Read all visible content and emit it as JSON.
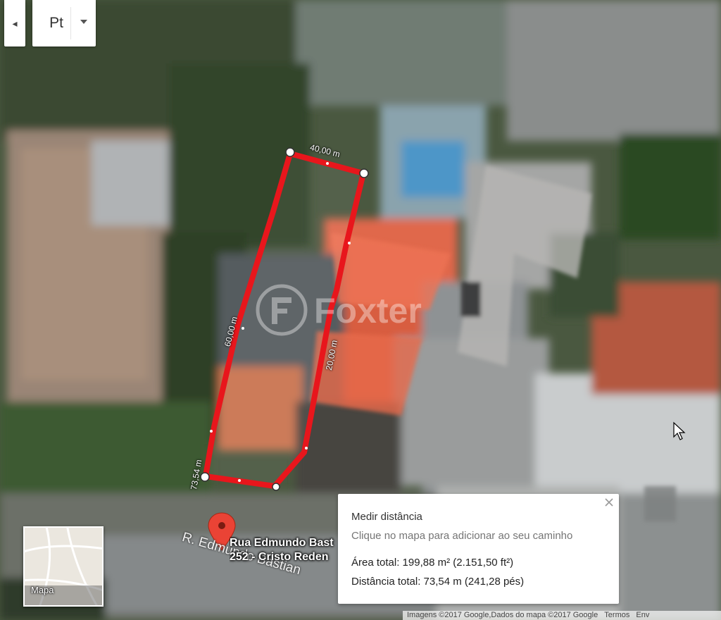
{
  "controls": {
    "back_label": "◂",
    "map_type_label": "Pt"
  },
  "measure": {
    "edge_labels": [
      "40,00 m",
      "60,00 m",
      "20,00 m",
      "73,54 m"
    ]
  },
  "pin": {
    "line1": "Rua Edmundo Bast",
    "line2": "252 - Cristo Reden"
  },
  "street_label": "R. Edmundo Bastian",
  "minimap": {
    "label": "Mapa"
  },
  "panel": {
    "title": "Medir distância",
    "hint": "Clique no mapa para adicionar ao seu caminho",
    "area": "Área total: 199,88 m² (2.151,50 ft²)",
    "distance": "Distância total: 73,54 m (241,28 pés)"
  },
  "footer": {
    "imagery": "Imagens ©2017 Google,Dados do mapa ©2017 Google",
    "terms": "Termos",
    "feedback": "Env"
  },
  "watermark": {
    "text": "Foxter"
  },
  "colors": {
    "measure_line": "#e8161c",
    "pin": "#ea4335"
  }
}
